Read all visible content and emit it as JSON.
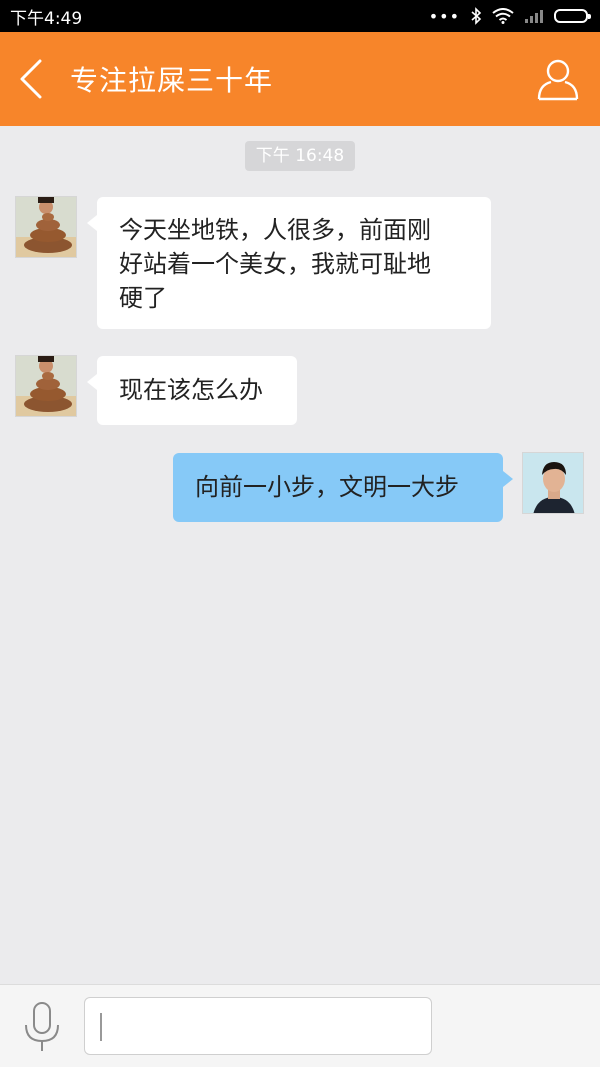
{
  "status_bar": {
    "time": "下午4:49",
    "dots": "•••"
  },
  "header": {
    "title": "专注拉屎三十年"
  },
  "chat": {
    "timestamp": "下午 16:48",
    "messages": [
      {
        "side": "in",
        "lines": [
          "今天坐地铁，人很多，前面刚",
          "好站着一个美女，我就可耻地",
          "硬了"
        ]
      },
      {
        "side": "in",
        "lines": [
          "现在该怎么办"
        ]
      },
      {
        "side": "out",
        "lines": [
          "向前一小步，文明一大步"
        ]
      }
    ]
  },
  "input": {
    "value": "",
    "placeholder": ""
  },
  "colors": {
    "header": "#f7852a",
    "incoming_bubble": "#ffffff",
    "outgoing_bubble": "#86c9f7",
    "background": "#ebebed"
  },
  "icons": {
    "back": "chevron-left-icon",
    "profile": "person-outline-icon",
    "mic": "microphone-icon",
    "bluetooth": "bluetooth-icon",
    "wifi": "wifi-icon",
    "signal": "signal-icon",
    "battery": "battery-icon"
  }
}
